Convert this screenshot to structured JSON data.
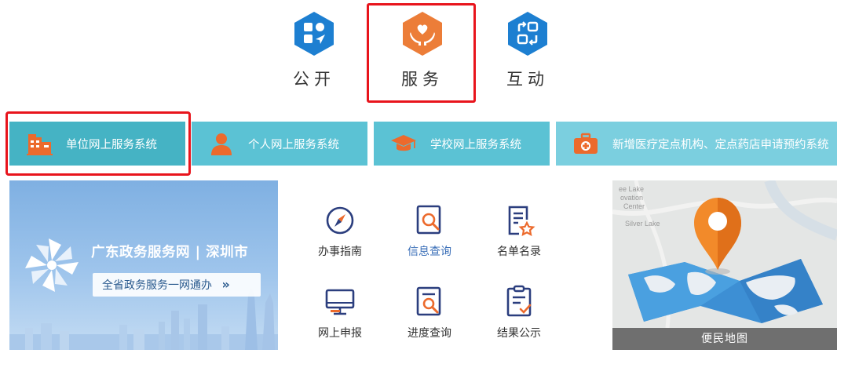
{
  "categories": [
    {
      "label": "公开",
      "icon": "apps-icon",
      "color": "#1d7fd1"
    },
    {
      "label": "服务",
      "icon": "hands-heart-icon",
      "color": "#ec7d38"
    },
    {
      "label": "互动",
      "icon": "interaction-icon",
      "color": "#1d7fd1"
    }
  ],
  "systems": [
    {
      "label": "单位网上服务系统",
      "icon": "building-icon"
    },
    {
      "label": "个人网上服务系统",
      "icon": "person-icon"
    },
    {
      "label": "学校网上服务系统",
      "icon": "graduation-cap-icon"
    },
    {
      "label": "新增医疗定点机构、定点药店申请预约系统",
      "icon": "medical-kit-icon"
    }
  ],
  "banner": {
    "title": "广东政务服务网 | 深圳市",
    "subtitle": "全省政务服务一网通办",
    "arrow": "»"
  },
  "services": [
    {
      "label": "办事指南",
      "icon": "compass-icon"
    },
    {
      "label": "信息查询",
      "icon": "search-document-icon"
    },
    {
      "label": "名单名录",
      "icon": "star-list-icon"
    },
    {
      "label": "网上申报",
      "icon": "monitor-icon"
    },
    {
      "label": "进度查询",
      "icon": "progress-search-icon"
    },
    {
      "label": "结果公示",
      "icon": "checklist-icon"
    }
  ],
  "map": {
    "label": "便民地图",
    "labels": [
      "ee Lake",
      "ovation",
      "Center",
      "Silver Lake"
    ]
  },
  "colors": {
    "accent_blue": "#1d7fd1",
    "accent_orange": "#ec7d38",
    "system_bar": "#5bc2d4",
    "highlight_red": "#e8141c"
  }
}
